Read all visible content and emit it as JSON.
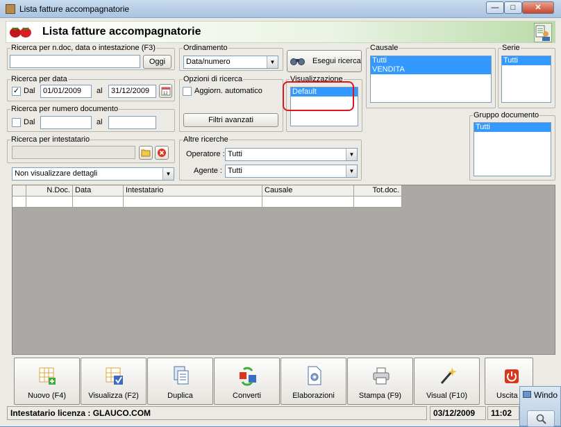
{
  "window": {
    "title": "Lista fatture accompagnatorie",
    "minimize": "—",
    "maximize": "□",
    "close": "✕"
  },
  "header": {
    "title": "Lista fatture accompagnatorie"
  },
  "search_ndoc": {
    "label": "Ricerca per n.doc, data o intestazione (F3)",
    "value": "",
    "button": "Oggi"
  },
  "search_date": {
    "label": "Ricerca per data",
    "dal_label": "Dal",
    "from": "01/01/2009",
    "al_label": "al",
    "to": "31/12/2009",
    "checked": "✓"
  },
  "search_number": {
    "label": "Ricerca per numero documento",
    "dal_label": "Dal",
    "al_label": "al",
    "from": "",
    "to": ""
  },
  "search_holder": {
    "label": "Ricerca per intestatario",
    "value": ""
  },
  "details_combo": {
    "value": "Non visualizzare dettagli"
  },
  "ordering": {
    "label": "Ordinamento",
    "value": "Data/numero"
  },
  "search_options": {
    "label": "Opzioni di ricerca",
    "auto_update": "Aggiorn. automatico",
    "advanced_filters": "Filtri avanzati"
  },
  "execute": {
    "label": "Esegui ricerca"
  },
  "visualization": {
    "label": "Visualizzazione",
    "items": [
      "Default"
    ]
  },
  "other_searches": {
    "label": "Altre ricerche",
    "operator_label": "Operatore :",
    "operator_value": "Tutti",
    "agent_label": "Agente :",
    "agent_value": "Tutti"
  },
  "causale": {
    "label": "Causale",
    "items": [
      "Tutti",
      "VENDITA"
    ]
  },
  "serie": {
    "label": "Serie",
    "items": [
      "Tutti"
    ]
  },
  "gruppo": {
    "label": "Gruppo documento",
    "items": [
      "Tutti"
    ]
  },
  "table": {
    "columns": [
      "",
      "N.Doc.",
      "Data",
      "Intestatario",
      "Causale",
      "Tot.doc."
    ]
  },
  "toolbar": {
    "buttons": [
      "Nuovo (F4)",
      "Visualizza (F2)",
      "Duplica",
      "Converti",
      "Elaborazioni",
      "Stampa (F9)",
      "Visual (F10)",
      "Uscita"
    ]
  },
  "status": {
    "license": "Intestatario licenza : GLAUCO.COM",
    "date": "03/12/2009",
    "time": "11:02"
  },
  "popup": {
    "title": "Windo"
  },
  "colors": {
    "selection": "#3399ff",
    "highlight": "#e0141e"
  }
}
